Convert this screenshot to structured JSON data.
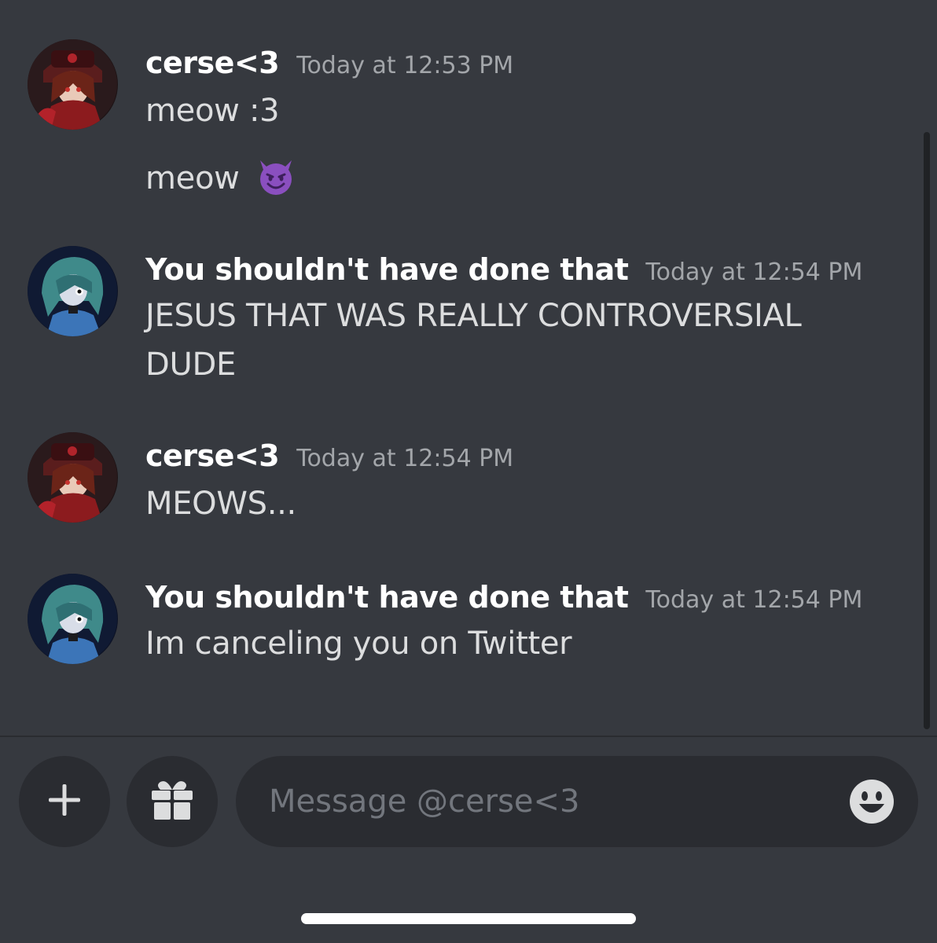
{
  "messages": [
    {
      "author": "cerse<3",
      "avatar": "cerse-avatar",
      "timestamp": "Today at 12:53 PM",
      "lines": [
        "meow :3",
        "meow"
      ],
      "emoji": "smiling-imp-emoji"
    },
    {
      "author": "You shouldn't have done that",
      "avatar": "dark-haired-avatar",
      "timestamp": "Today at 12:54 PM",
      "lines": [
        "JESUS THAT WAS REALLY CONTROVERSIAL",
        "DUDE"
      ]
    },
    {
      "author": "cerse<3",
      "avatar": "cerse-avatar",
      "timestamp": "Today at 12:54 PM",
      "lines": [
        "MEOWS..."
      ]
    },
    {
      "author": "You shouldn't have done that",
      "avatar": "dark-haired-avatar",
      "timestamp": "Today at 12:54 PM",
      "lines": [
        "Im canceling you on Twitter"
      ]
    }
  ],
  "composer": {
    "placeholder": "Message @cerse<3",
    "add_icon": "plus-icon",
    "gift_icon": "gift-icon",
    "emoji_icon": "smiley-icon"
  },
  "colors": {
    "background": "#36393f",
    "input_background": "#2a2c31",
    "author": "#ffffff",
    "timestamp": "#a3a6aa",
    "message_text": "#dcddde",
    "placeholder": "#72767d"
  }
}
